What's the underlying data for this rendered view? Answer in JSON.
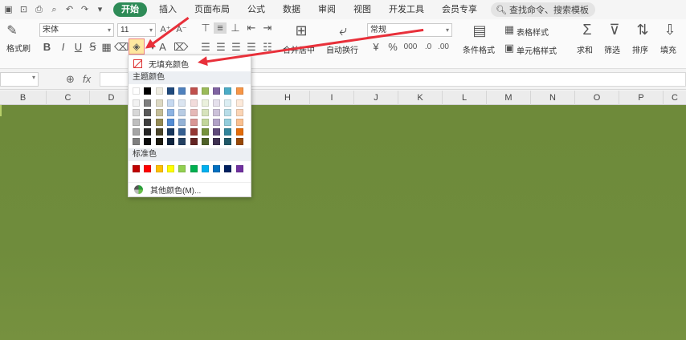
{
  "menubar": {
    "tabs": [
      {
        "label": "开始",
        "active": true
      },
      {
        "label": "插入"
      },
      {
        "label": "页面布局"
      },
      {
        "label": "公式"
      },
      {
        "label": "数据"
      },
      {
        "label": "审阅"
      },
      {
        "label": "视图"
      },
      {
        "label": "开发工具"
      },
      {
        "label": "会员专享"
      }
    ],
    "search_placeholder": "查找命令、搜索模板"
  },
  "ribbon": {
    "format_painter": "格式刷",
    "font_name": "宋体",
    "font_size": "11",
    "merge_center": "合并居中",
    "wrap_text": "自动换行",
    "number_format": "常规",
    "conditional_format": "条件格式",
    "table_style": "表格样式",
    "cell_style": "单元格样式",
    "sum": "求和",
    "filter": "筛选",
    "sort": "排序",
    "fill": "填充"
  },
  "formula_bar": {
    "fx_label": "fx"
  },
  "columns": [
    "B",
    "C",
    "D",
    "H",
    "I",
    "J",
    "K",
    "L",
    "M",
    "N",
    "O",
    "P",
    "C"
  ],
  "color_picker": {
    "no_fill_label": "无填充颜色",
    "theme_label": "主题颜色",
    "standard_label": "标准色",
    "more_colors_label": "其他颜色(M)...",
    "theme_colors": [
      [
        "#ffffff",
        "#f2f2f2",
        "#d8d8d8",
        "#bfbfbf",
        "#a5a5a5",
        "#7f7f7f"
      ],
      [
        "#000000",
        "#7f7f7f",
        "#595959",
        "#3f3f3f",
        "#262626",
        "#0c0c0c"
      ],
      [
        "#eeece1",
        "#ddd9c3",
        "#c4bd97",
        "#948a54",
        "#4a452a",
        "#1d1b10"
      ],
      [
        "#1f497d",
        "#c6d9f0",
        "#8db3e2",
        "#548dd4",
        "#17365d",
        "#0f243e"
      ],
      [
        "#4f81bd",
        "#dbe5f1",
        "#b8cce4",
        "#95b3d7",
        "#366092",
        "#244061"
      ],
      [
        "#c0504d",
        "#f2dcdb",
        "#e5b9b7",
        "#d99694",
        "#953734",
        "#632423"
      ],
      [
        "#9bbb59",
        "#ebf1dd",
        "#d7e3bc",
        "#c3d69b",
        "#76923c",
        "#4f6128"
      ],
      [
        "#8064a2",
        "#e5e0ec",
        "#ccc1d9",
        "#b2a2c7",
        "#5f497a",
        "#3f3151"
      ],
      [
        "#4bacc6",
        "#dbeef3",
        "#b7dde8",
        "#92cddc",
        "#31859b",
        "#205867"
      ],
      [
        "#f79646",
        "#fdeada",
        "#fbd5b5",
        "#fac08f",
        "#e36c09",
        "#974806"
      ]
    ],
    "standard_colors": [
      "#c00000",
      "#ff0000",
      "#ffc000",
      "#ffff00",
      "#92d050",
      "#00b050",
      "#00b0f0",
      "#0070c0",
      "#002060",
      "#7030a0"
    ]
  },
  "annotation_color": "#e8303a",
  "sheet_fill_color": "#6e8a3a"
}
